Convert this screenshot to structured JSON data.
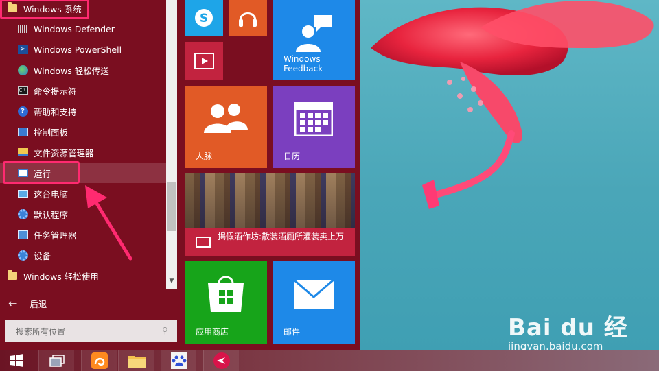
{
  "start_menu": {
    "items": [
      {
        "label": "Windows 系统",
        "icon": "folder-icon",
        "level": "top"
      },
      {
        "label": "Windows Defender",
        "icon": "defender-icon",
        "level": "sub"
      },
      {
        "label": "Windows PowerShell",
        "icon": "powershell-icon",
        "level": "sub"
      },
      {
        "label": "Windows 轻松传送",
        "icon": "easy-transfer-icon",
        "level": "sub"
      },
      {
        "label": "命令提示符",
        "icon": "command-prompt-icon",
        "level": "sub"
      },
      {
        "label": "帮助和支持",
        "icon": "help-icon",
        "level": "sub"
      },
      {
        "label": "控制面板",
        "icon": "control-panel-icon",
        "level": "sub"
      },
      {
        "label": "文件资源管理器",
        "icon": "file-explorer-icon",
        "level": "sub"
      },
      {
        "label": "运行",
        "icon": "run-icon",
        "level": "sub",
        "selected": true
      },
      {
        "label": "这台电脑",
        "icon": "this-pc-icon",
        "level": "sub"
      },
      {
        "label": "默认程序",
        "icon": "default-programs-icon",
        "level": "sub"
      },
      {
        "label": "任务管理器",
        "icon": "task-manager-icon",
        "level": "sub"
      },
      {
        "label": "设备",
        "icon": "devices-icon",
        "level": "sub"
      },
      {
        "label": "Windows 轻松使用",
        "icon": "folder-icon",
        "level": "top"
      }
    ],
    "back_label": "后退",
    "search_placeholder": "搜索所有位置"
  },
  "tiles": {
    "skype": {
      "icon": "skype-icon",
      "color": "#1ea5e8"
    },
    "music": {
      "icon": "headphones-icon",
      "color": "#e15a26"
    },
    "video": {
      "icon": "video-icon",
      "color": "#c2233f"
    },
    "feedback": {
      "label": "Windows\nFeedback",
      "icon": "feedback-icon",
      "color": "#1e89e8"
    },
    "people": {
      "label": "人脉",
      "icon": "people-icon",
      "color": "#e15a26"
    },
    "calendar": {
      "label": "日历",
      "icon": "calendar-icon",
      "color": "#7b3fbf"
    },
    "news": {
      "headline": "揭假酒作坊:散装酒厕所灌装卖上万",
      "icon": "news-icon",
      "color": "#c2233f"
    },
    "store": {
      "label": "应用商店",
      "icon": "store-icon",
      "color": "#17a41a"
    },
    "mail": {
      "label": "邮件",
      "icon": "mail-icon",
      "color": "#1e89e8"
    }
  },
  "taskbar": {
    "apps": [
      "windows-start-icon",
      "task-view-icon",
      "uc-browser-icon",
      "folder-icon",
      "baidu-icon",
      "app-icon"
    ]
  },
  "watermark": {
    "brand": "Bai du 经验",
    "url": "jingyan.baidu.com"
  },
  "colors": {
    "start_menu_bg": "#7a0e20",
    "highlight": "#ff2a70"
  }
}
